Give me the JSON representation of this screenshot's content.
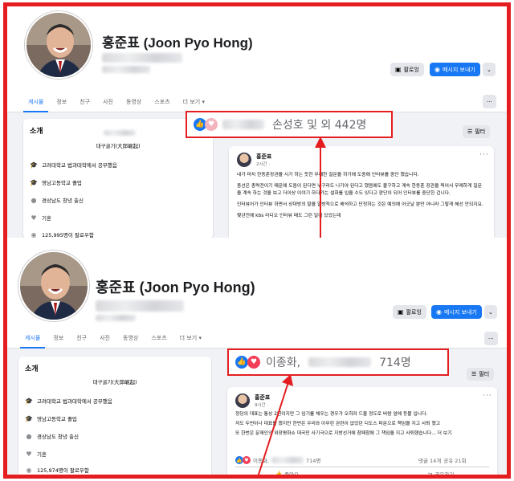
{
  "profile": {
    "name": "홍준표 (Joon Pyo Hong)"
  },
  "buttons": {
    "follow": "팔로잉",
    "message": "메시지 보내기",
    "more_menu": "⌄",
    "options": "···"
  },
  "tabs": [
    "게시물",
    "정보",
    "친구",
    "사진",
    "동영상",
    "스포츠",
    "더 보기"
  ],
  "intro": {
    "title": "소개",
    "subtitle": "대구굴기(大邱崛起)",
    "items": [
      {
        "icon": "graduation-cap-icon",
        "text": "고려대학교 법과대학에서 공부했음"
      },
      {
        "icon": "graduation-cap-icon",
        "text": "영남고등학교 졸업"
      },
      {
        "icon": "location-pin-icon",
        "text": "경상남도 창녕 출신"
      },
      {
        "icon": "heart-icon",
        "text": "기혼"
      }
    ],
    "followers_top": "125,995명이 팔로우함",
    "followers_bottom": "125,974명이 팔로우함"
  },
  "filter_label": "필터",
  "top_post": {
    "author": "홍준표",
    "time": "2시간 · ",
    "paragraphs": [
      "내가 마치 한동훈장관을 시기 하는 듯한 무례한 질문을 하기에 도중에 인터뷰를 중단 했습니다.",
      "총선은 총력전이기 때문에 도움이 된다면 누구라도 나가야 된다고 했음에도 불구하고 계속 한동훈 장관을 찍어서 무례하게 질문을 계속 하는 것을 보고 더이상 이야기 하다가는 설화를 입을 수도 있다고 판단이 되어 인터뷰를 중단한 겁니다.",
      "인터뷰어가 인터뷰 하면서 상대방의 말을 일방적으로 해석하고 단정하는 것은 예의에 어긋날 뿐만 아니라 그렇게 해선 안되지요.",
      "몇년전에 kbs 라디오 인터뷰 때도 그런 일이 있었는데"
    ],
    "reaction_callout": "손성호 및 외 442명"
  },
  "bottom_post": {
    "author": "홍준표",
    "time": "9시간 · ",
    "paragraphs": [
      "정당의 대표는 통상 2년이지만 그 임기를 채우는 경우가 오히려 드물 정도로 바람 앞에 등불 입니다.",
      "저도 두번이나 대표를 했지만 한번은 우리와 아무런 관련이 없었던 디도스 파문으로 책임을 지고 사퇴 했고",
      "또 한번은 문재인의 위장평화쇼 대국민 사기극으로 지방선거에 참패함에 그 책임을 지고 사퇴했습니다... 더 보기"
    ],
    "reaction_callout_name": "이종화,",
    "reaction_callout_count": "714명",
    "reaction_small_name": "이종화,",
    "reaction_small_count": "714명",
    "comments": "댓글 14개",
    "shares": "공유 21회",
    "like_action": "좋아요",
    "share_action": "공유하기"
  }
}
